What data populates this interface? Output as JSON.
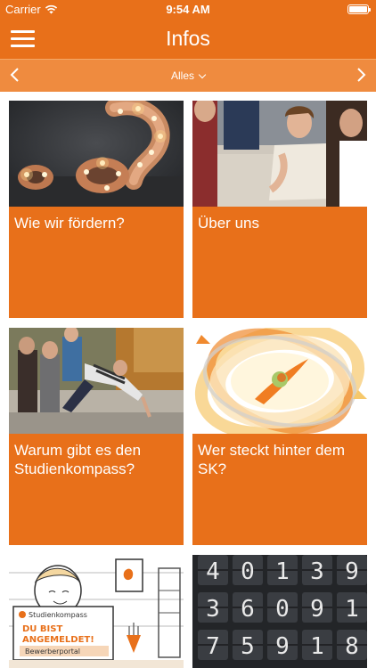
{
  "status": {
    "carrier": "Carrier",
    "time": "9:54 AM",
    "battery_level": 1.0
  },
  "nav": {
    "title": "Infos",
    "menu_icon": "hamburger-menu-icon"
  },
  "filter": {
    "selected": "Alles",
    "prev_icon": "chevron-left-icon",
    "next_icon": "chevron-right-icon"
  },
  "cards": [
    {
      "title": "Wie wir fördern?",
      "image": "illuminated-question-mark"
    },
    {
      "title": "Über uns",
      "image": "students-group-photo"
    },
    {
      "title": "Warum gibt es den Studienkompass?",
      "image": "team-building-outdoor"
    },
    {
      "title": "Wer steckt hinter dem SK?",
      "image": "orbit-logo-graphic"
    },
    {
      "title": "",
      "image": "bewerberportal-illustration",
      "illustration_text": [
        "Studienkompass",
        "DU BIST",
        "ANGEMELDET!",
        "Bewerberportal"
      ]
    },
    {
      "title": "",
      "image": "flip-clock-numbers",
      "digits": [
        "4",
        "0",
        "1",
        "3",
        "9",
        "3",
        "6",
        "0",
        "9",
        "1",
        "7",
        "5",
        "9",
        "1",
        "8"
      ]
    }
  ],
  "colors": {
    "primary": "#e8701a",
    "filter_bar": "#ef8b3f",
    "background": "#ffffff",
    "text": "#ffffff"
  }
}
